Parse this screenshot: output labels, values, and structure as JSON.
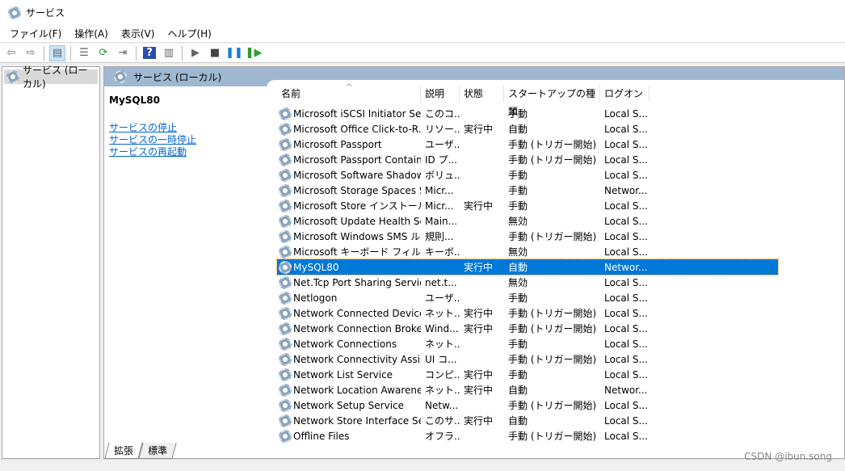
{
  "window": {
    "title": "サービス",
    "icon": "gear-icon"
  },
  "menu": [
    "ファイル(F)",
    "操作(A)",
    "表示(V)",
    "ヘルプ(H)"
  ],
  "toolbar": [
    {
      "icon": "back-arrow-icon",
      "glyph": "⇦"
    },
    {
      "icon": "forward-arrow-icon",
      "glyph": "⇨"
    },
    {
      "icon": "show-hide-console-tree-icon",
      "glyph": "▤",
      "active": true
    },
    {
      "icon": "properties-icon",
      "glyph": "☰"
    },
    {
      "icon": "refresh-icon",
      "glyph": "⟳"
    },
    {
      "icon": "export-list-icon",
      "glyph": "⇥"
    },
    {
      "icon": "help-icon",
      "glyph": "?"
    },
    {
      "icon": "show-action-pane-icon",
      "glyph": "▥"
    },
    {
      "icon": "start-service-icon",
      "glyph": "▶"
    },
    {
      "icon": "stop-service-icon",
      "glyph": "■"
    },
    {
      "icon": "pause-service-icon",
      "glyph": "❚❚"
    },
    {
      "icon": "restart-service-icon",
      "glyph": "❚▶"
    }
  ],
  "tree": {
    "item": "サービス (ローカル)"
  },
  "main": {
    "header": "サービス (ローカル)",
    "selected_service": "MySQL80",
    "actions": [
      "サービスの停止",
      "サービスの一時停止",
      "サービスの再起動"
    ],
    "columns": [
      "名前",
      "説明",
      "状態",
      "スタートアップの種類",
      "ログオン"
    ],
    "sort_indicator": "^",
    "rows": [
      [
        "Microsoft iSCSI Initiator Ser...",
        "このコ...",
        "",
        "手動",
        "Local S..."
      ],
      [
        "Microsoft Office Click-to-R...",
        "リソー...",
        "実行中",
        "自動",
        "Local S..."
      ],
      [
        "Microsoft Passport",
        "ユーザ...",
        "",
        "手動 (トリガー開始)",
        "Local S..."
      ],
      [
        "Microsoft Passport Container",
        "ID プ...",
        "",
        "手動 (トリガー開始)",
        "Local S..."
      ],
      [
        "Microsoft Software Shadow...",
        "ボリュ...",
        "",
        "手動",
        "Local S..."
      ],
      [
        "Microsoft Storage Spaces S...",
        "Micr...",
        "",
        "手動",
        "Networ..."
      ],
      [
        "Microsoft Store インストール ...",
        "Micr...",
        "実行中",
        "手動",
        "Local S..."
      ],
      [
        "Microsoft Update Health Se...",
        "Main...",
        "",
        "無効",
        "Local S..."
      ],
      [
        "Microsoft Windows SMS ル...",
        "規則...",
        "",
        "手動 (トリガー開始)",
        "Local S..."
      ],
      [
        "Microsoft キーボード フィルター",
        "キーボ...",
        "",
        "無効",
        "Local S..."
      ],
      [
        "MySQL80",
        "",
        "実行中",
        "自動",
        "Networ..."
      ],
      [
        "Net.Tcp Port Sharing Service",
        "net.t...",
        "",
        "無効",
        "Local S..."
      ],
      [
        "Netlogon",
        "ユーザ...",
        "",
        "手動",
        "Local S..."
      ],
      [
        "Network Connected Device...",
        "ネット...",
        "実行中",
        "手動 (トリガー開始)",
        "Local S..."
      ],
      [
        "Network Connection Broker",
        "Wind...",
        "実行中",
        "手動 (トリガー開始)",
        "Local S..."
      ],
      [
        "Network Connections",
        "ネット...",
        "",
        "手動",
        "Local S..."
      ],
      [
        "Network Connectivity Assist...",
        "UI コ...",
        "",
        "手動 (トリガー開始)",
        "Local S..."
      ],
      [
        "Network List Service",
        "コンピ...",
        "実行中",
        "手動",
        "Local S..."
      ],
      [
        "Network Location Awareness",
        "ネット...",
        "実行中",
        "自動",
        "Networ..."
      ],
      [
        "Network Setup Service",
        "Netw...",
        "",
        "手動 (トリガー開始)",
        "Local S..."
      ],
      [
        "Network Store Interface Ser...",
        "このサ...",
        "実行中",
        "自動",
        "Local S..."
      ],
      [
        "Offline Files",
        "オフラ...",
        "",
        "手動 (トリガー開始)",
        "Local S..."
      ]
    ],
    "selected_index": 10
  },
  "tabs": [
    "拡張",
    "標準"
  ],
  "watermark": "CSDN @ibun.song",
  "colors": {
    "selection": "#0078d7",
    "header_band": "#9fb7d0",
    "link": "#0066cc"
  }
}
